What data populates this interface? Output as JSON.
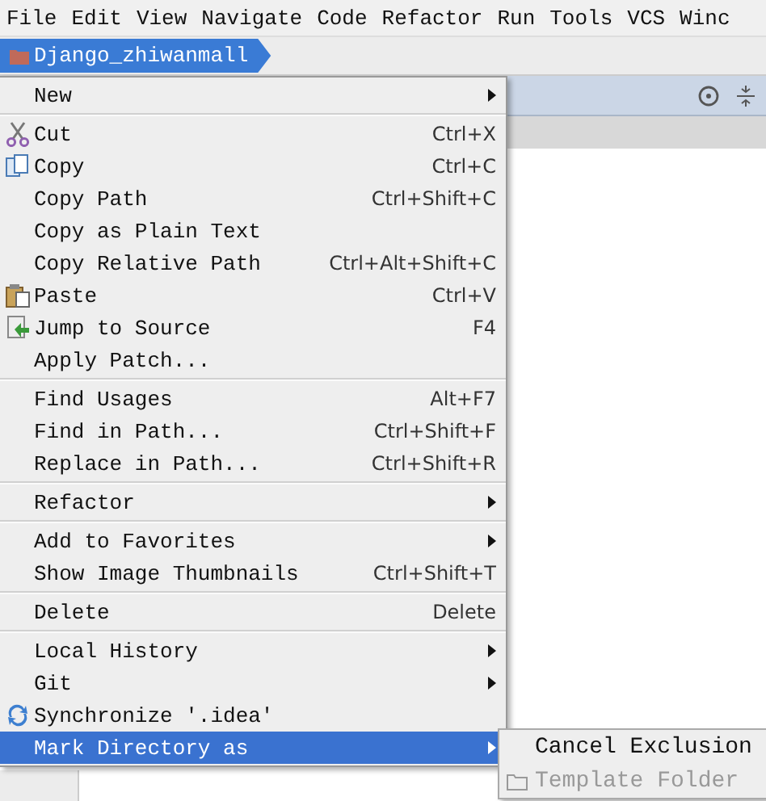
{
  "menu_bar": [
    "File",
    "Edit",
    "View",
    "Navigate",
    "Code",
    "Refactor",
    "Run",
    "Tools",
    "VCS",
    "Winc"
  ],
  "breadcrumb": {
    "label": "Django_zhiwanmall"
  },
  "context_menu": {
    "groups": [
      [
        {
          "label": "New",
          "submenu": true,
          "selected": false
        }
      ],
      [
        {
          "label": "Cut",
          "shortcut": "Ctrl+X",
          "selected": false
        },
        {
          "label": "Copy",
          "shortcut": "Ctrl+C",
          "selected": false
        },
        {
          "label": "Copy Path",
          "shortcut": "Ctrl+Shift+C",
          "selected": false
        },
        {
          "label": "Copy as Plain Text",
          "selected": false
        },
        {
          "label": "Copy Relative Path",
          "shortcut": "Ctrl+Alt+Shift+C",
          "selected": false
        },
        {
          "label": "Paste",
          "shortcut": "Ctrl+V",
          "selected": false
        },
        {
          "label": "Jump to Source",
          "shortcut": "F4",
          "selected": false
        },
        {
          "label": "Apply Patch...",
          "selected": false
        }
      ],
      [
        {
          "label": "Find Usages",
          "shortcut": "Alt+F7",
          "selected": false
        },
        {
          "label": "Find in Path...",
          "shortcut": "Ctrl+Shift+F",
          "selected": false
        },
        {
          "label": "Replace in Path...",
          "shortcut": "Ctrl+Shift+R",
          "selected": false
        }
      ],
      [
        {
          "label": "Refactor",
          "submenu": true,
          "selected": false
        }
      ],
      [
        {
          "label": "Add to Favorites",
          "submenu": true,
          "selected": false
        },
        {
          "label": "Show Image Thumbnails",
          "shortcut": "Ctrl+Shift+T",
          "selected": false
        }
      ],
      [
        {
          "label": "Delete",
          "shortcut": "Delete",
          "selected": false
        }
      ],
      [
        {
          "label": "Local History",
          "submenu": true,
          "selected": false
        },
        {
          "label": "Git",
          "submenu": true,
          "selected": false
        },
        {
          "label": "Synchronize '.idea'",
          "selected": false
        },
        {
          "label": "Mark Directory as",
          "submenu": true,
          "selected": true
        }
      ]
    ]
  },
  "submenu": {
    "items": [
      {
        "label": "Cancel Exclusion",
        "disabled": false
      },
      {
        "label": "Template Folder",
        "disabled": true
      }
    ]
  }
}
